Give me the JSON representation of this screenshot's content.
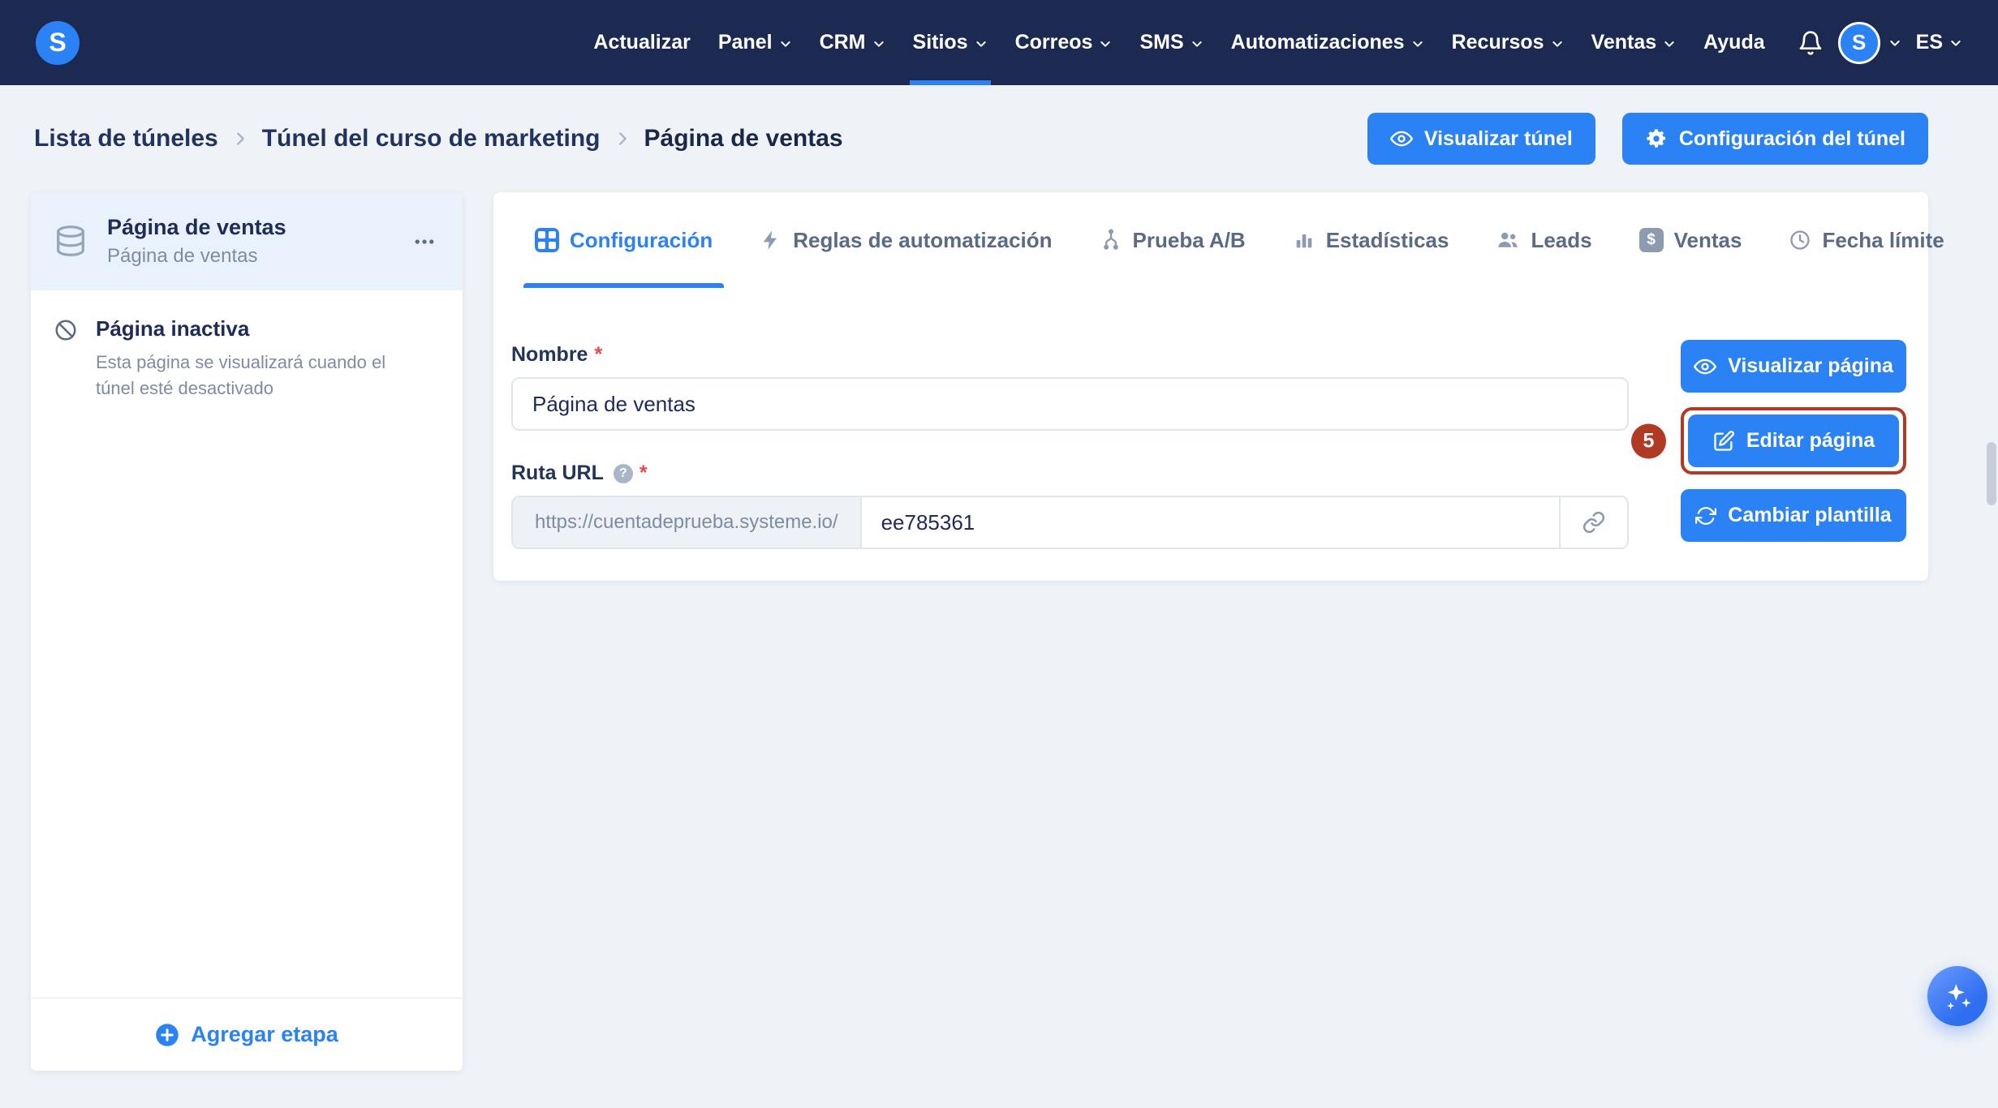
{
  "navbar": {
    "logo": "S",
    "items": [
      {
        "label": "Actualizar"
      },
      {
        "label": "Panel"
      },
      {
        "label": "CRM"
      },
      {
        "label": "Sitios"
      },
      {
        "label": "Correos"
      },
      {
        "label": "SMS"
      },
      {
        "label": "Automatizaciones"
      },
      {
        "label": "Recursos"
      },
      {
        "label": "Ventas"
      },
      {
        "label": "Ayuda"
      }
    ],
    "avatar": "S",
    "language": "ES"
  },
  "breadcrumb": {
    "items": [
      "Lista de túneles",
      "Túnel del curso de marketing",
      "Página de ventas"
    ]
  },
  "header_actions": {
    "preview_funnel": "Visualizar túnel",
    "funnel_settings": "Configuración del túnel"
  },
  "sidebar": {
    "step": {
      "title": "Página de ventas",
      "subtitle": "Página de ventas"
    },
    "inactive_title": "Página inactiva",
    "inactive_desc": "Esta página se visualizará cuando el túnel esté desactivado",
    "add_step": "Agregar etapa"
  },
  "tabs": [
    {
      "label": "Configuración"
    },
    {
      "label": "Reglas de automatización"
    },
    {
      "label": "Prueba A/B"
    },
    {
      "label": "Estadísticas"
    },
    {
      "label": "Leads"
    },
    {
      "label": "Ventas"
    },
    {
      "label": "Fecha límite"
    }
  ],
  "form": {
    "name_label": "Nombre",
    "name_value": "Página de ventas",
    "url_label": "Ruta URL",
    "url_prefix": "https://cuentadeprueba.systeme.io/",
    "url_value": "ee785361",
    "required_mark": "*",
    "help_glyph": "?"
  },
  "side_actions": {
    "preview_page": "Visualizar página",
    "edit_page": "Editar página",
    "change_template": "Cambiar plantilla",
    "badge": "5"
  },
  "glyphs": {
    "dollar": "$"
  },
  "colors": {
    "navbar_bg": "#1c2a52",
    "accent": "#2b82f5",
    "annotation": "#b13a25"
  }
}
